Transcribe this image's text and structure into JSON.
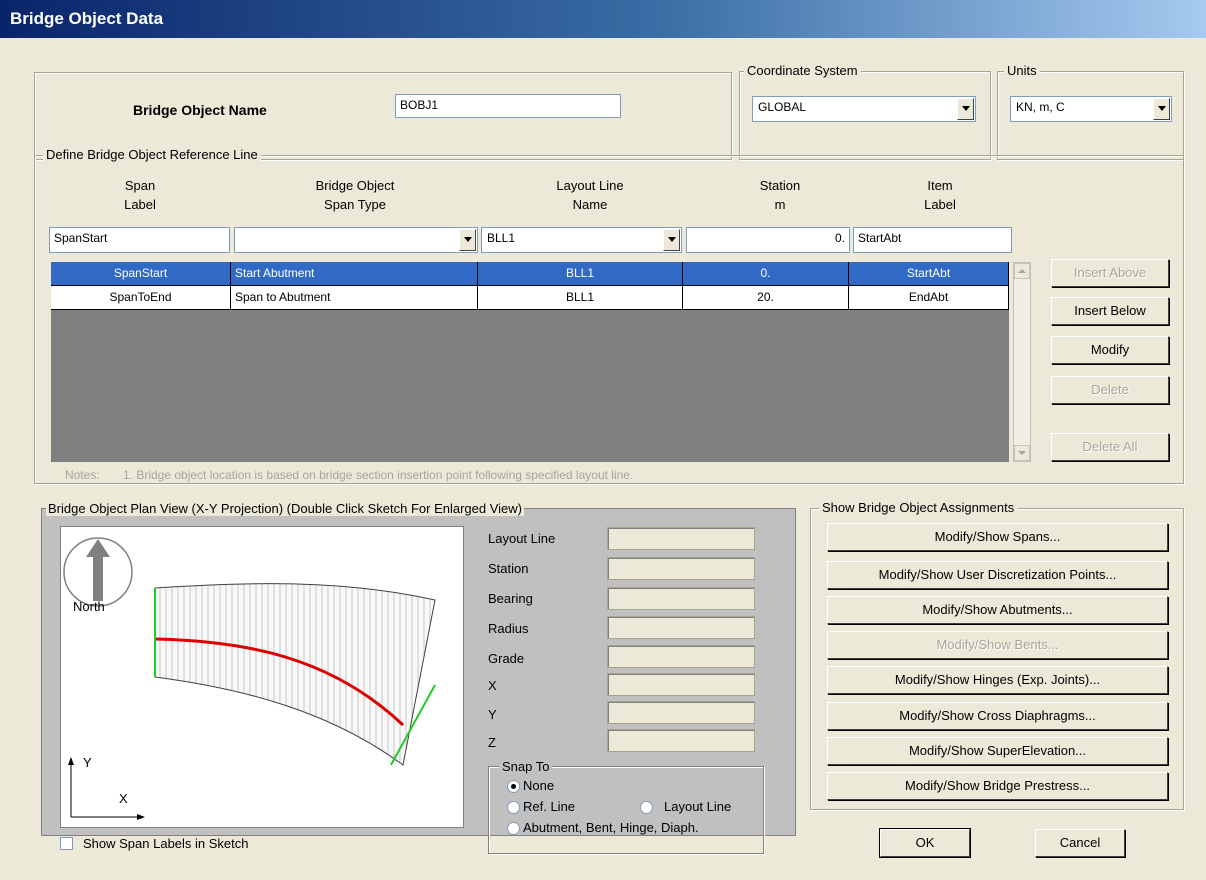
{
  "window": {
    "title": "Bridge Object Data"
  },
  "name_section": {
    "label": "Bridge Object Name",
    "value": "BOBJ1"
  },
  "coordinate_system": {
    "label": "Coordinate System",
    "value": "GLOBAL"
  },
  "units": {
    "label": "Units",
    "value": "KN, m, C"
  },
  "reference_line": {
    "title": "Define Bridge Object Reference Line",
    "headers": [
      {
        "line1": "Span",
        "line2": "Label"
      },
      {
        "line1": "Bridge Object",
        "line2": "Span Type"
      },
      {
        "line1": "Layout Line",
        "line2": "Name"
      },
      {
        "line1": "Station",
        "line2": "m"
      },
      {
        "line1": "Item",
        "line2": "Label"
      }
    ],
    "edit_row": {
      "span_label": "SpanStart",
      "span_type": "",
      "layout_line": "BLL1",
      "station": "0.",
      "item_label": "StartAbt"
    },
    "rows": [
      {
        "span_label": "SpanStart",
        "span_type": "Start Abutment",
        "layout_line": "BLL1",
        "station": "0.",
        "item_label": "StartAbt",
        "selected": true
      },
      {
        "span_label": "SpanToEnd",
        "span_type": "Span to Abutment",
        "layout_line": "BLL1",
        "station": "20.",
        "item_label": "EndAbt",
        "selected": false
      }
    ],
    "buttons": {
      "insert_above": "Insert Above",
      "insert_below": "Insert Below",
      "modify": "Modify",
      "delete": "Delete",
      "delete_all": "Delete All"
    },
    "notes_label": "Notes:",
    "note_1": "1.  Bridge object location is based on bridge section insertion point following specified layout line."
  },
  "plan_view": {
    "title": "Bridge Object Plan View (X-Y Projection)     (Double Click Sketch For Enlarged View)",
    "north_label": "North",
    "axis_y": "Y",
    "axis_x": "X",
    "show_span_labels": "Show Span Labels in Sketch",
    "colors": {
      "reference_line": "#e00000",
      "ends": "#22cc22",
      "arrow": "#808080"
    },
    "info_labels": [
      "Layout Line",
      "Station",
      "Bearing",
      "Radius",
      "Grade",
      "X",
      "Y",
      "Z"
    ],
    "snap_to": {
      "title": "Snap To",
      "none": "None",
      "ref_line": "Ref. Line",
      "layout_line": "Layout Line",
      "abutment": "Abutment, Bent, Hinge, Diaph.",
      "selected": "None"
    }
  },
  "assignments": {
    "title": "Show Bridge Object Assignments",
    "buttons": [
      {
        "label": "Modify/Show Spans...",
        "enabled": true
      },
      {
        "label": "Modify/Show User Discretization Points...",
        "enabled": true
      },
      {
        "label": "Modify/Show Abutments...",
        "enabled": true
      },
      {
        "label": "Modify/Show Bents...",
        "enabled": false
      },
      {
        "label": "Modify/Show Hinges (Exp. Joints)...",
        "enabled": true
      },
      {
        "label": "Modify/Show Cross Diaphragms...",
        "enabled": true
      },
      {
        "label": "Modify/Show SuperElevation...",
        "enabled": true
      },
      {
        "label": "Modify/Show Bridge Prestress...",
        "enabled": true
      }
    ]
  },
  "footer": {
    "ok": "OK",
    "cancel": "Cancel"
  },
  "colors": {
    "selection": "#316ac5",
    "grid_background": "#808080",
    "dialog": "#ece9d8"
  }
}
